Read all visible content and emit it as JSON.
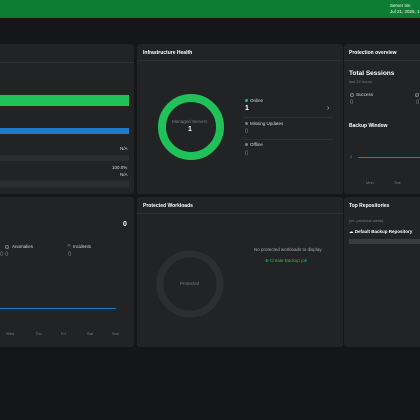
{
  "topbar": {
    "server_label": "Server tim",
    "datetime": "Jul 21, 2025, 1"
  },
  "panel_left_top": {
    "percent_label": "100.0%",
    "na_1": "N/A",
    "na_2": "N/A",
    "bars": [
      {
        "name": "green",
        "color": "#21c15a",
        "fill": 1.0
      },
      {
        "name": "blue",
        "color": "#1a7ccc",
        "fill": 1.0
      }
    ]
  },
  "panel_left_bottom": {
    "count": "0",
    "anomalies_label": "Anomalies",
    "anomalies_value": "0",
    "incidents_label": "Incidents",
    "incidents_value": "0",
    "first_value": "0",
    "days": [
      "Wed",
      "Thu",
      "Fri",
      "Sat",
      "Sun"
    ]
  },
  "infra": {
    "title": "Infrastructure Health",
    "managed_label": "Managed Servers",
    "managed_value": "1",
    "online_label": "Online",
    "online_value": "1",
    "missing_label": "Missing Updates",
    "missing_value": "0",
    "offline_label": "Offline",
    "offline_value": "0",
    "accent": "#21c15a"
  },
  "protected": {
    "title": "Protected Workloads",
    "donut_label": "Protected",
    "empty_message": "No protected workloads to display.",
    "create_link": "Create Backup job"
  },
  "protection": {
    "title": "Protection overview",
    "sessions_title": "Total Sessions",
    "sessions_subtitle": "last 24 hours",
    "success_label": "Success",
    "success_value": "0",
    "second_value": "0",
    "window_title": "Backup Window",
    "y_tick": "0",
    "days": [
      "Mon",
      "Tue"
    ]
  },
  "repos": {
    "title": "Top Repositories",
    "subtitle": "(vs. previous week)",
    "repo_name": "Default Backup Repository"
  }
}
